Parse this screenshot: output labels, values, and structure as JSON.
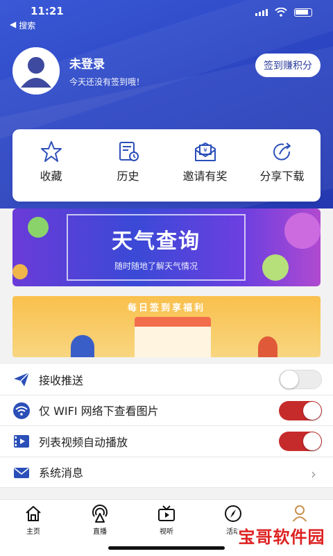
{
  "status_bar": {
    "time": "11:21"
  },
  "back_nav": {
    "label": "搜索"
  },
  "profile": {
    "username": "未登录",
    "subtitle": "今天还没有签到哦！",
    "signin_button": "签到赚积分"
  },
  "quick_actions": [
    {
      "label": "收藏",
      "icon": "star-icon"
    },
    {
      "label": "历史",
      "icon": "history-icon"
    },
    {
      "label": "邀请有奖",
      "icon": "invite-envelope-icon"
    },
    {
      "label": "分享下载",
      "icon": "share-icon"
    }
  ],
  "banners": {
    "weather": {
      "title": "天气查询",
      "subtitle": "随时随地了解天气情况"
    },
    "daily": {
      "title": "每日签到享福利"
    }
  },
  "settings": [
    {
      "label": "接收推送",
      "icon": "paper-plane-icon",
      "control": "toggle",
      "enabled": false
    },
    {
      "label": "仅 WIFI 网络下查看图片",
      "icon": "wifi-icon",
      "control": "toggle",
      "enabled": true
    },
    {
      "label": "列表视频自动播放",
      "icon": "video-icon",
      "control": "toggle",
      "enabled": true
    },
    {
      "label": "系统消息",
      "icon": "mail-icon",
      "control": "chevron"
    }
  ],
  "tabs": [
    {
      "label": "主页",
      "icon": "home-icon",
      "active": false
    },
    {
      "label": "直播",
      "icon": "live-broadcast-icon",
      "active": false
    },
    {
      "label": "视听",
      "icon": "tv-icon",
      "active": false
    },
    {
      "label": "活动",
      "icon": "compass-icon",
      "active": false
    },
    {
      "label": "",
      "icon": "user-icon",
      "active": true
    }
  ],
  "watermark": {
    "text": "宝哥软件园"
  },
  "colors": {
    "accent": "#2c46c4",
    "toggle_on": "#c62b2b",
    "active_tab": "#c7914d"
  }
}
